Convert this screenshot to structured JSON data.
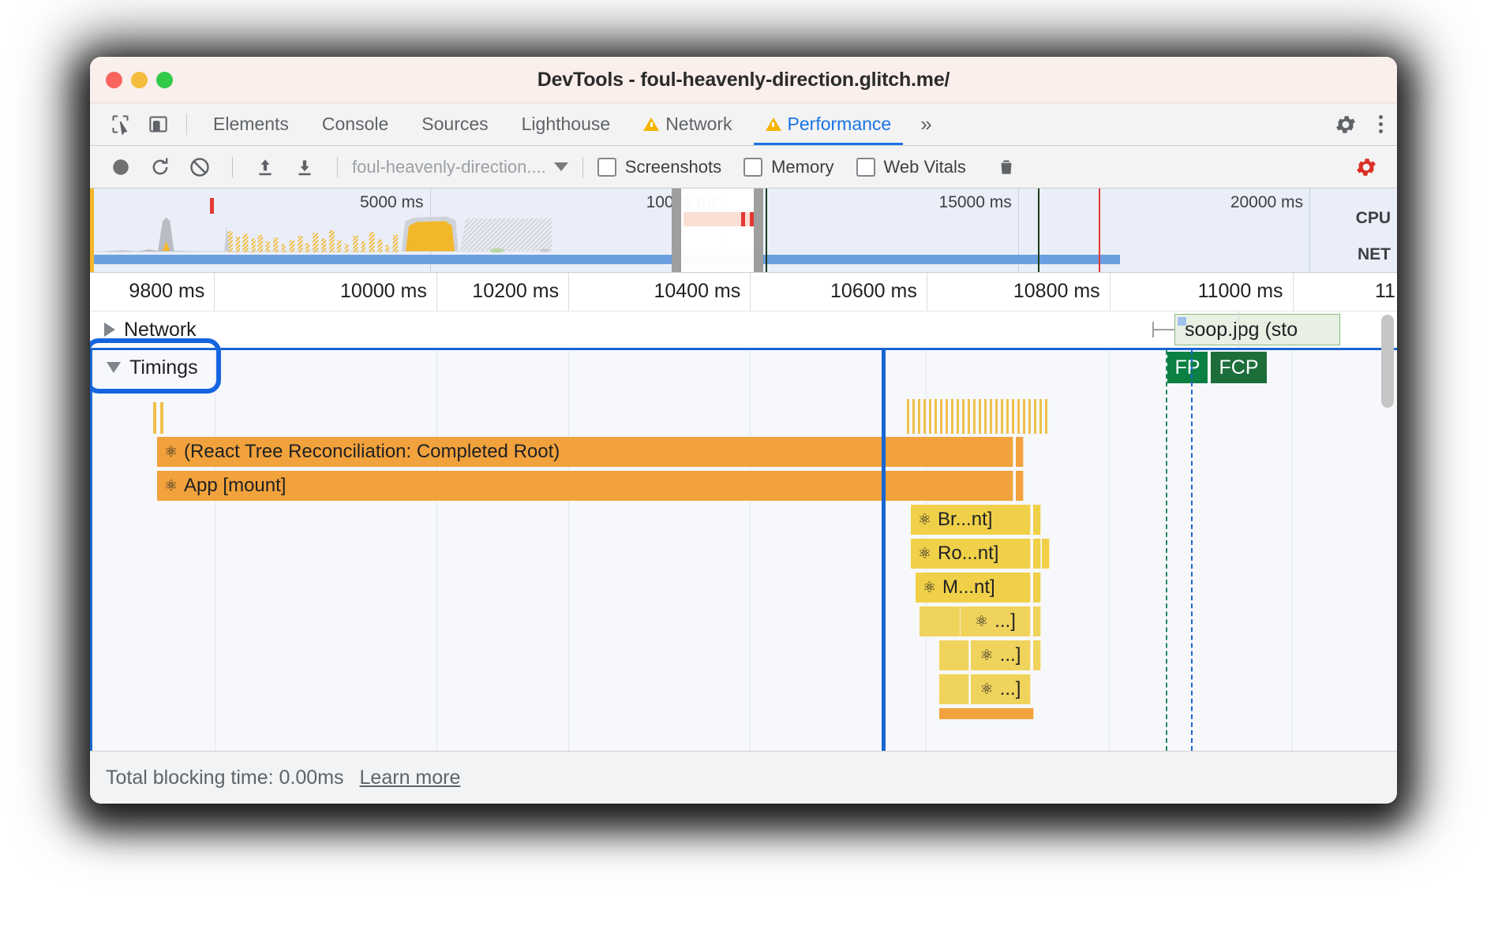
{
  "window": {
    "title": "DevTools - foul-heavenly-direction.glitch.me/",
    "traffic_lights": [
      "close-red",
      "minimize-yellow",
      "zoom-green"
    ]
  },
  "tabstrip": {
    "left_icons": [
      {
        "name": "inspect-element-icon",
        "glyph": "inspect"
      },
      {
        "name": "device-toolbar-icon",
        "glyph": "device"
      }
    ],
    "tabs": [
      {
        "label": "Elements",
        "warning": false,
        "selected": false
      },
      {
        "label": "Console",
        "warning": false,
        "selected": false
      },
      {
        "label": "Sources",
        "warning": false,
        "selected": false
      },
      {
        "label": "Lighthouse",
        "warning": false,
        "selected": false
      },
      {
        "label": "Network",
        "warning": true,
        "selected": false
      },
      {
        "label": "Performance",
        "warning": true,
        "selected": true
      }
    ],
    "overflow_label": "»",
    "settings_icon": "gear-icon",
    "more_icon": "kebab-menu-icon"
  },
  "perf_toolbar": {
    "record_label": "record-button",
    "reload_label": "reload-and-record-button",
    "clear_label": "clear-recording-button",
    "upload_label": "load-profile-button",
    "download_label": "save-profile-button",
    "profile_name": "foul-heavenly-direction....",
    "checkboxes": [
      {
        "label": "Screenshots",
        "checked": false
      },
      {
        "label": "Memory",
        "checked": false
      },
      {
        "label": "Web Vitals",
        "checked": false
      }
    ],
    "trash_label": "collect-garbage-button",
    "capture_settings_label": "capture-settings-button"
  },
  "overview": {
    "ticks": [
      {
        "label": "5000 ms",
        "x_pct": 26.0
      },
      {
        "label": "10000 ms",
        "x_pct": 48.6
      },
      {
        "label": "15000 ms",
        "x_pct": 71.0
      },
      {
        "label": "20000 ms",
        "x_pct": 93.3
      }
    ],
    "lane_labels": [
      "CPU",
      "NET"
    ],
    "selection_start_pct": 44.5,
    "selection_end_pct": 51.5
  },
  "ruler": {
    "ticks": [
      {
        "label": "9800 ms",
        "x_pct": 9.5
      },
      {
        "label": "10000 ms",
        "x_pct": 26.5
      },
      {
        "label": "10200 ms",
        "x_pct": 36.6
      },
      {
        "label": "10400 ms",
        "x_pct": 50.5
      },
      {
        "label": "10600 ms",
        "x_pct": 64.0
      },
      {
        "label": "10800 ms",
        "x_pct": 78.0
      },
      {
        "label": "11000 ms",
        "x_pct": 92.0
      },
      {
        "label": "11",
        "x_pct": 99.6
      }
    ]
  },
  "flame": {
    "groups": [
      {
        "name": "Network",
        "label": "Network",
        "expanded": false
      },
      {
        "name": "Timings",
        "label": "Timings",
        "expanded": true,
        "highlighted": true
      }
    ],
    "network_items": [
      {
        "label": "soop.jpg (sto",
        "kind": "request-chip"
      }
    ],
    "timing_markers": [
      {
        "label": "FP",
        "kind": "first-paint"
      },
      {
        "label": "FCP",
        "kind": "first-contentful-paint"
      }
    ],
    "bars": [
      {
        "label": "(React Tree Reconciliation: Completed Root)",
        "icon": "react-atom-icon",
        "depth": 0,
        "color": "orange"
      },
      {
        "label": "App [mount]",
        "icon": "react-atom-icon",
        "depth": 1,
        "color": "orange"
      },
      {
        "label": "Br...nt]",
        "icon": "react-atom-icon",
        "depth": 2,
        "color": "yellow"
      },
      {
        "label": "Ro...nt]",
        "icon": "react-atom-icon",
        "depth": 3,
        "color": "yellow"
      },
      {
        "label": "M...nt]",
        "icon": "react-atom-icon",
        "depth": 4,
        "color": "yellow"
      },
      {
        "label": "...]",
        "icon": "react-atom-icon",
        "depth": 5,
        "color": "yellow2"
      },
      {
        "label": "...]",
        "icon": "react-atom-icon",
        "depth": 6,
        "color": "yellow2"
      },
      {
        "label": "...]",
        "icon": "react-atom-icon",
        "depth": 7,
        "color": "yellow2"
      }
    ]
  },
  "statusbar": {
    "total_blocking_time": "Total blocking time: 0.00ms",
    "learn_more": "Learn more"
  },
  "colors": {
    "accent_blue": "#1a73e8",
    "highlight_blue": "#1565e0",
    "warning_yellow": "#f5b400",
    "record_red": "#d93025",
    "bar_orange": "#f2a23c",
    "bar_yellow": "#efd048",
    "fp_green": "#0a8043",
    "fcp_green": "#1e6e3c",
    "titlebar_bg": "#faefeb",
    "overview_bg": "#e9eef8"
  }
}
